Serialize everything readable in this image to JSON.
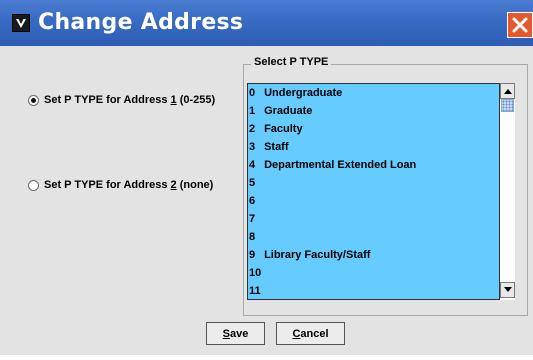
{
  "window": {
    "title": "Change Address",
    "app_icon": "v-logo-icon",
    "close_icon": "close-icon"
  },
  "options": [
    {
      "prefix": "Set P TYPE for Address ",
      "mnemonic": "1",
      "suffix": " (0-255)",
      "checked": true
    },
    {
      "prefix": "Set P TYPE for Address ",
      "mnemonic": "2",
      "suffix": " (none)",
      "checked": false
    }
  ],
  "ptype_group": {
    "legend": "Select P TYPE",
    "items": [
      {
        "num": "0",
        "label": "Undergraduate"
      },
      {
        "num": "1",
        "label": "Graduate"
      },
      {
        "num": "2",
        "label": "Faculty"
      },
      {
        "num": "3",
        "label": "Staff"
      },
      {
        "num": "4",
        "label": "Departmental Extended Loan"
      },
      {
        "num": "5",
        "label": ""
      },
      {
        "num": "6",
        "label": ""
      },
      {
        "num": "7",
        "label": ""
      },
      {
        "num": "8",
        "label": ""
      },
      {
        "num": "9",
        "label": "Library Faculty/Staff"
      },
      {
        "num": "10",
        "label": ""
      },
      {
        "num": "11",
        "label": ""
      }
    ]
  },
  "buttons": {
    "save": {
      "mnemonic": "S",
      "rest": "ave"
    },
    "cancel": {
      "mnemonic": "C",
      "rest": "ancel"
    }
  },
  "colors": {
    "titlebar": "#3a6cc4",
    "list_background": "#66ccff",
    "dialog_background": "#e3e3e3",
    "close_button": "#e6592d"
  }
}
